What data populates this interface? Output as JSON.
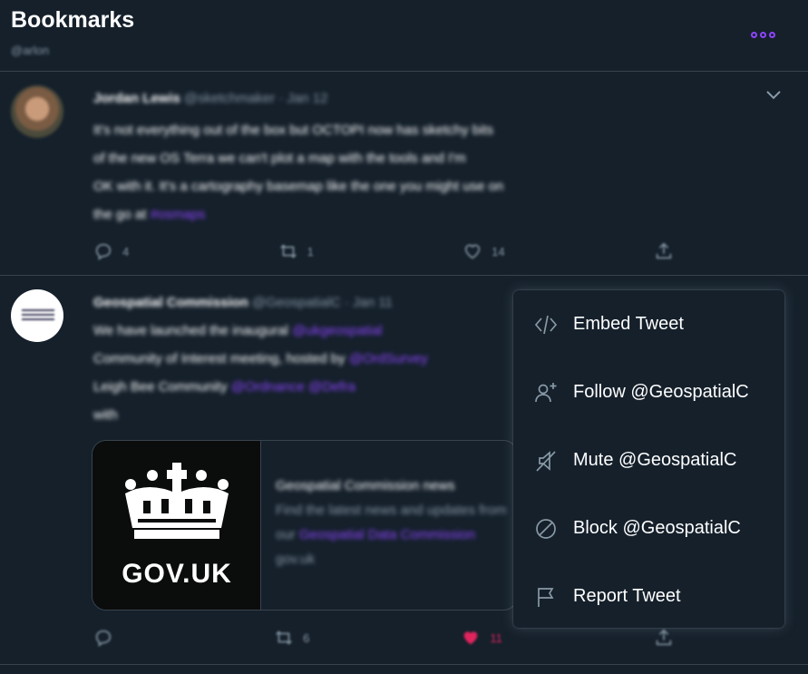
{
  "header": {
    "title": "Bookmarks",
    "handle": "@arlon",
    "more_icon": "more-dots-icon",
    "accent_color": "#8e44ff"
  },
  "tweets": [
    {
      "author_name": "Jordan Lewis",
      "author_meta": "@sketchmaker · Jan 12",
      "body_lines": [
        "It's not everything out of the box but OCTOPI now has sketchy bits",
        "of the new OS Terra we can't plot a map with the tools and I'm",
        "OK with it. It's a cartography basemap like the one you might use on",
        "the go at "
      ],
      "body_link": "#osmaps",
      "actions": {
        "reply_count": "4",
        "retweet_count": "1",
        "like_count": "14"
      }
    },
    {
      "author_name": "Geospatial Commission",
      "author_meta": "@GeospatialC · Jan 11",
      "body_lines": [
        "We have launched the inaugural",
        "Community of Interest meeting, hosted by",
        "Leigh Bee Community",
        "with"
      ],
      "body_links": [
        "@ukgeospatial",
        "@OrdSurvey",
        "@Ordnance",
        "@Defra"
      ],
      "card": {
        "image_text": "GOV.UK",
        "title": "Geospatial Commission news",
        "description": "Find the latest news and updates from our",
        "description_link": "Geospatial Data Commission",
        "domain": "gov.uk"
      },
      "actions": {
        "reply_count": "",
        "retweet_count": "6",
        "like_count": "11",
        "like_color": "#e0245e"
      }
    }
  ],
  "menu": {
    "items": [
      {
        "label": "Embed Tweet",
        "icon": "code-icon"
      },
      {
        "label": "Follow @GeospatialC",
        "icon": "follow-user-icon"
      },
      {
        "label": "Mute @GeospatialC",
        "icon": "mute-icon"
      },
      {
        "label": "Block @GeospatialC",
        "icon": "block-icon"
      },
      {
        "label": "Report Tweet",
        "icon": "flag-icon"
      }
    ]
  }
}
